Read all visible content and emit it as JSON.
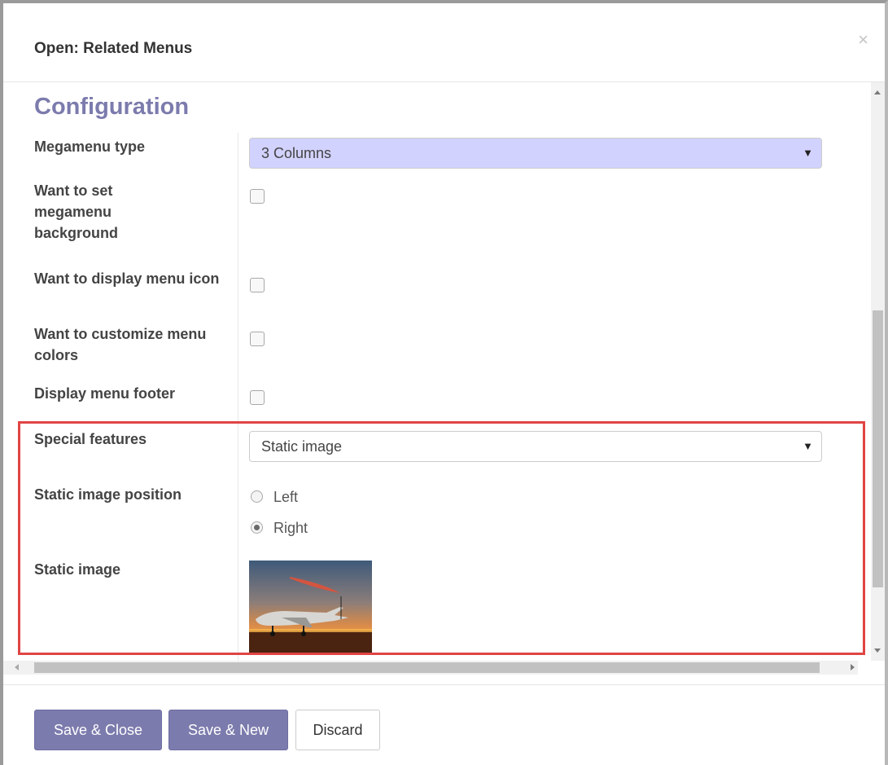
{
  "dialog": {
    "title": "Open: Related Menus",
    "close_icon": "×"
  },
  "form": {
    "section_title": "Configuration",
    "megamenu_type": {
      "label": "Megamenu type",
      "value": "3 Columns"
    },
    "set_background": {
      "label": "Want to set megamenu background",
      "checked": false
    },
    "display_icon": {
      "label": "Want to display menu icon",
      "checked": false
    },
    "customize_colors": {
      "label": "Want to customize menu colors",
      "checked": false
    },
    "menu_footer": {
      "label": "Display menu footer",
      "checked": false
    },
    "special_features": {
      "label": "Special features",
      "value": "Static image"
    },
    "image_position": {
      "label": "Static image position",
      "options": [
        "Left",
        "Right"
      ],
      "selected": "Right"
    },
    "static_image": {
      "label": "Static image",
      "icon": "airplane-sunset-image"
    }
  },
  "footer": {
    "save_close": "Save & Close",
    "save_new": "Save & New",
    "discard": "Discard"
  },
  "colors": {
    "accent": "#7c7bad",
    "select_fill": "#d2d2ff",
    "highlight": "#e04444"
  },
  "icons": {
    "dropdown": "caret-down-icon",
    "close": "close-icon"
  }
}
